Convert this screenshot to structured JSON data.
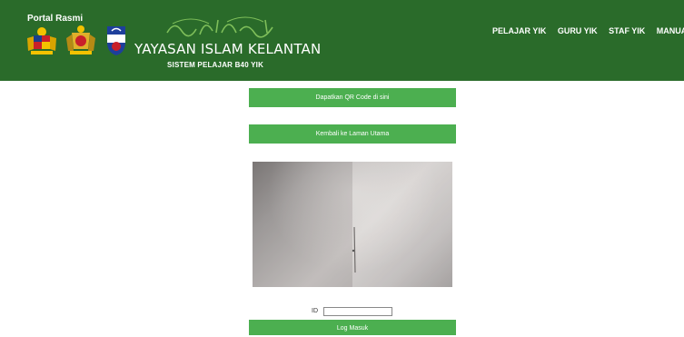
{
  "header": {
    "portal_label": "Portal Rasmi",
    "brand_title": "YAYASAN ISLAM KELANTAN",
    "brand_subtitle": "SISTEM PELAJAR B40 YIK",
    "nav": [
      "PELAJAR YIK",
      "GURU YIK",
      "STAF YIK",
      "MANUAL"
    ]
  },
  "main": {
    "qr_button": "Dapatkan QR Code di sini",
    "home_button": "Kembali ke Laman Utama",
    "id_label": "ID",
    "id_value": "",
    "login_button": "Log Masuk"
  },
  "colors": {
    "header_bg": "#2a6b2a",
    "button_bg": "#4caf50"
  }
}
